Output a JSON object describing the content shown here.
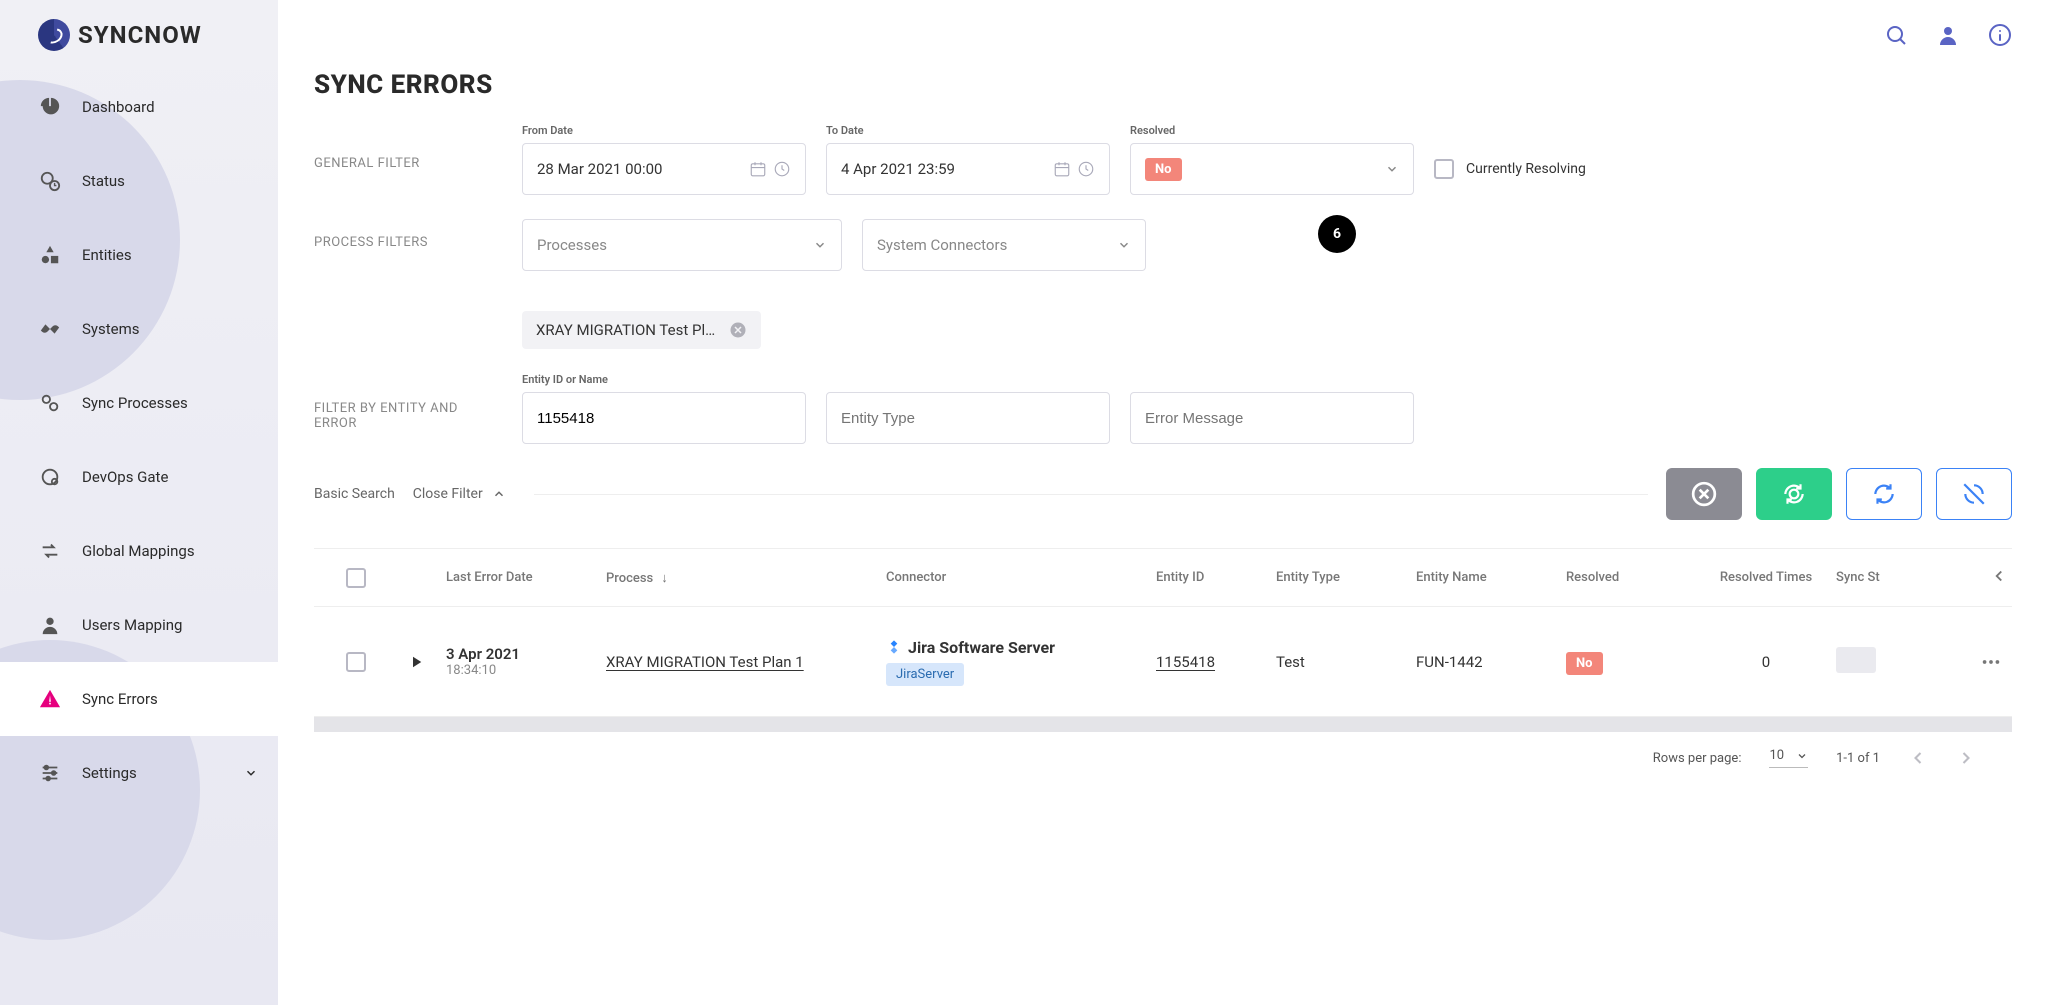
{
  "brand": "SYNCNOW",
  "sidebar": {
    "items": [
      {
        "label": "Dashboard"
      },
      {
        "label": "Status"
      },
      {
        "label": "Entities"
      },
      {
        "label": "Systems"
      },
      {
        "label": "Sync Processes"
      },
      {
        "label": "DevOps Gate"
      },
      {
        "label": "Global Mappings"
      },
      {
        "label": "Users Mapping"
      },
      {
        "label": "Sync Errors"
      },
      {
        "label": "Settings"
      }
    ]
  },
  "page": {
    "title": "SYNC ERRORS"
  },
  "general_filter": {
    "label": "GENERAL FILTER",
    "from_date_label": "From Date",
    "from_date": "28 Mar 2021 00:00",
    "to_date_label": "To Date",
    "to_date": "4 Apr 2021 23:59",
    "resolved_label": "Resolved",
    "resolved_value": "No",
    "currently_resolving_label": "Currently Resolving"
  },
  "process_filters": {
    "label": "PROCESS FILTERS",
    "processes_placeholder": "Processes",
    "connectors_placeholder": "System Connectors",
    "chip": "XRAY MIGRATION Test Pl…",
    "step_marker": "6"
  },
  "entity_filter": {
    "label": "FILTER BY ENTITY AND ERROR",
    "entity_id_label": "Entity ID or Name",
    "entity_id_value": "1155418",
    "entity_type_placeholder": "Entity Type",
    "error_message_placeholder": "Error Message"
  },
  "toolbar": {
    "basic_search": "Basic Search",
    "close_filter": "Close Filter"
  },
  "table": {
    "headers": {
      "last_error_date": "Last Error Date",
      "process": "Process",
      "connector": "Connector",
      "entity_id": "Entity ID",
      "entity_type": "Entity Type",
      "entity_name": "Entity Name",
      "resolved": "Resolved",
      "resolved_times": "Resolved Times",
      "sync_status": "Sync St"
    },
    "rows": [
      {
        "date": "3 Apr 2021",
        "time": "18:34:10",
        "process": "XRAY MIGRATION Test Plan 1",
        "connector_title": "Jira Software Server",
        "connector_badge": "JiraServer",
        "entity_id": "1155418",
        "entity_type": "Test",
        "entity_name": "FUN-1442",
        "resolved": "No",
        "resolved_times": "0"
      }
    ]
  },
  "pagination": {
    "rows_per_page_label": "Rows per page:",
    "rows_per_page_value": "10",
    "range": "1-1 of 1"
  }
}
